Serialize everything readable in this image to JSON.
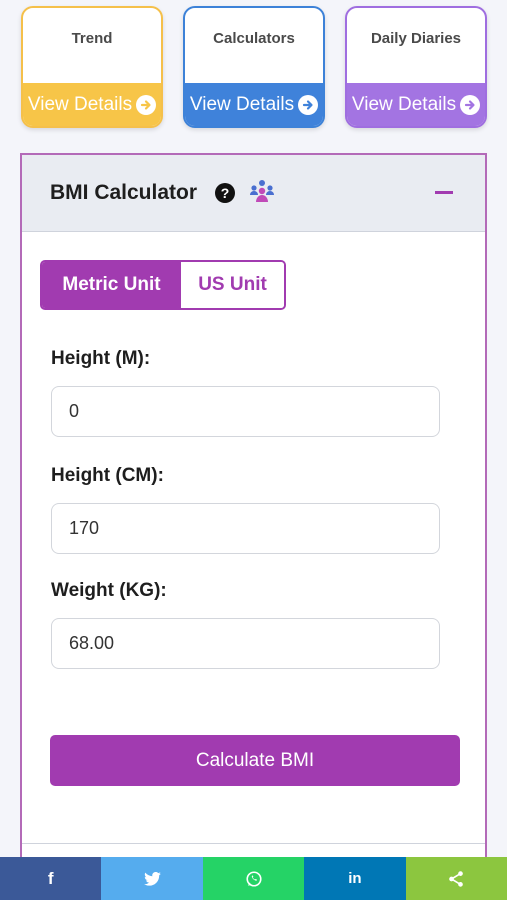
{
  "cards": [
    {
      "title": "Trend",
      "action": "View Details"
    },
    {
      "title": "Calculators",
      "action": "View Details"
    },
    {
      "title": "Daily Diaries",
      "action": "View Details"
    }
  ],
  "panel": {
    "title": "BMI Calculator",
    "help_glyph": "?",
    "tabs": {
      "metric": "Metric Unit",
      "us": "US Unit",
      "selected": "Metric Unit"
    },
    "fields": [
      {
        "label": "Height (M):",
        "value": "0"
      },
      {
        "label": "Height (CM):",
        "value": "170"
      },
      {
        "label": "Weight (KG):",
        "value": "68.00"
      }
    ],
    "submit_label": "Calculate BMI"
  },
  "share_bar": {
    "facebook": "f",
    "twitter": "twitter-bird-icon",
    "whatsapp": "whatsapp-icon",
    "linkedin": "in",
    "share": "share-icon"
  },
  "colors": {
    "accent": "#a13bb0",
    "trend": "#f7c548",
    "calculators": "#3f82da",
    "diaries": "#a374e2"
  }
}
